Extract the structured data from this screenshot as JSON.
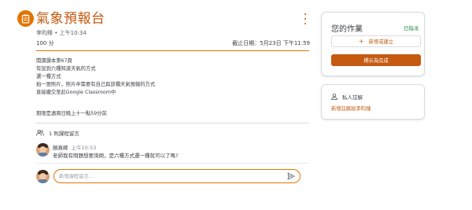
{
  "assignment": {
    "title": "氣象預報台",
    "author": "李昀臻",
    "posted_time": "上午10:34",
    "meta_separator": "•",
    "points": "100 分",
    "due_label": "截止日期：",
    "due_value": "5月23日 下午11:59",
    "description_lines": [
      "閱讀課本第67頁",
      "有說到六種知道天氣的方式",
      "選一種方式",
      "拍一張照片，照片中需要有自己與該種天氣預報的方式",
      "直接繳交至此Google Classroom中"
    ],
    "deadline_note": "期限是週周日晚上十一點59分前"
  },
  "class_comments": {
    "header": "1 則課程留言",
    "comments": [
      {
        "author": "顏真卿",
        "time": "上午10:53",
        "text": "老師我有問題想要詢問，是六種方式選一種就可以了嗎?"
      }
    ],
    "input_placeholder": "新增課程留言..."
  },
  "your_work": {
    "title": "您的作業",
    "status": "已指派",
    "add_button": "新增或建立",
    "mark_done_button": "標示為完成"
  },
  "private_comments": {
    "title": "私人註解",
    "add_link": "新增註解給李昀臻"
  },
  "colors": {
    "accent": "#c55a11",
    "accent_light": "#e37400",
    "assigned_green": "#188038"
  },
  "icons": [
    "assignment-icon",
    "more-vert-icon",
    "people-icon",
    "send-icon",
    "plus-icon",
    "person-icon"
  ]
}
